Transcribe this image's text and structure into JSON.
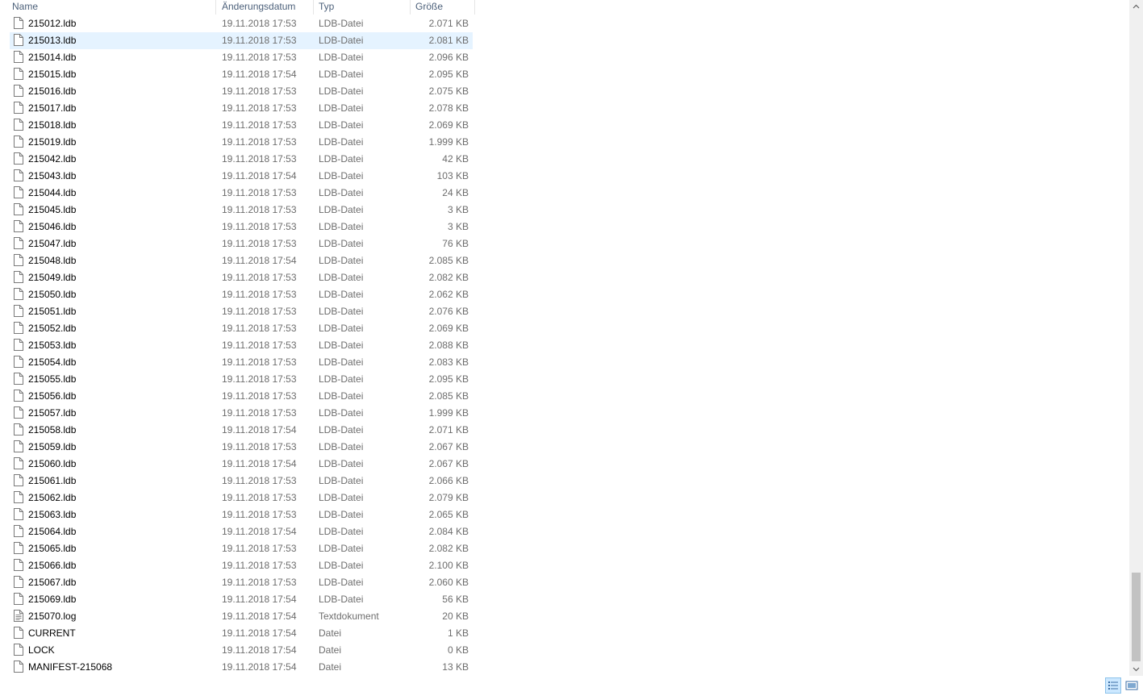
{
  "columns": {
    "name": "Name",
    "date": "Änderungsdatum",
    "type": "Typ",
    "size": "Größe"
  },
  "files": [
    {
      "name": "215012.ldb",
      "date": "19.11.2018 17:53",
      "type": "LDB-Datei",
      "size": "2.071 KB",
      "icon": "file-icon"
    },
    {
      "name": "215013.ldb",
      "date": "19.11.2018 17:53",
      "type": "LDB-Datei",
      "size": "2.081 KB",
      "icon": "file-icon",
      "selected": true
    },
    {
      "name": "215014.ldb",
      "date": "19.11.2018 17:53",
      "type": "LDB-Datei",
      "size": "2.096 KB",
      "icon": "file-icon"
    },
    {
      "name": "215015.ldb",
      "date": "19.11.2018 17:54",
      "type": "LDB-Datei",
      "size": "2.095 KB",
      "icon": "file-icon"
    },
    {
      "name": "215016.ldb",
      "date": "19.11.2018 17:53",
      "type": "LDB-Datei",
      "size": "2.075 KB",
      "icon": "file-icon"
    },
    {
      "name": "215017.ldb",
      "date": "19.11.2018 17:53",
      "type": "LDB-Datei",
      "size": "2.078 KB",
      "icon": "file-icon"
    },
    {
      "name": "215018.ldb",
      "date": "19.11.2018 17:53",
      "type": "LDB-Datei",
      "size": "2.069 KB",
      "icon": "file-icon"
    },
    {
      "name": "215019.ldb",
      "date": "19.11.2018 17:53",
      "type": "LDB-Datei",
      "size": "1.999 KB",
      "icon": "file-icon"
    },
    {
      "name": "215042.ldb",
      "date": "19.11.2018 17:53",
      "type": "LDB-Datei",
      "size": "42 KB",
      "icon": "file-icon"
    },
    {
      "name": "215043.ldb",
      "date": "19.11.2018 17:54",
      "type": "LDB-Datei",
      "size": "103 KB",
      "icon": "file-icon"
    },
    {
      "name": "215044.ldb",
      "date": "19.11.2018 17:53",
      "type": "LDB-Datei",
      "size": "24 KB",
      "icon": "file-icon"
    },
    {
      "name": "215045.ldb",
      "date": "19.11.2018 17:53",
      "type": "LDB-Datei",
      "size": "3 KB",
      "icon": "file-icon"
    },
    {
      "name": "215046.ldb",
      "date": "19.11.2018 17:53",
      "type": "LDB-Datei",
      "size": "3 KB",
      "icon": "file-icon"
    },
    {
      "name": "215047.ldb",
      "date": "19.11.2018 17:53",
      "type": "LDB-Datei",
      "size": "76 KB",
      "icon": "file-icon"
    },
    {
      "name": "215048.ldb",
      "date": "19.11.2018 17:54",
      "type": "LDB-Datei",
      "size": "2.085 KB",
      "icon": "file-icon"
    },
    {
      "name": "215049.ldb",
      "date": "19.11.2018 17:53",
      "type": "LDB-Datei",
      "size": "2.082 KB",
      "icon": "file-icon"
    },
    {
      "name": "215050.ldb",
      "date": "19.11.2018 17:53",
      "type": "LDB-Datei",
      "size": "2.062 KB",
      "icon": "file-icon"
    },
    {
      "name": "215051.ldb",
      "date": "19.11.2018 17:53",
      "type": "LDB-Datei",
      "size": "2.076 KB",
      "icon": "file-icon"
    },
    {
      "name": "215052.ldb",
      "date": "19.11.2018 17:53",
      "type": "LDB-Datei",
      "size": "2.069 KB",
      "icon": "file-icon"
    },
    {
      "name": "215053.ldb",
      "date": "19.11.2018 17:53",
      "type": "LDB-Datei",
      "size": "2.088 KB",
      "icon": "file-icon"
    },
    {
      "name": "215054.ldb",
      "date": "19.11.2018 17:53",
      "type": "LDB-Datei",
      "size": "2.083 KB",
      "icon": "file-icon"
    },
    {
      "name": "215055.ldb",
      "date": "19.11.2018 17:53",
      "type": "LDB-Datei",
      "size": "2.095 KB",
      "icon": "file-icon"
    },
    {
      "name": "215056.ldb",
      "date": "19.11.2018 17:53",
      "type": "LDB-Datei",
      "size": "2.085 KB",
      "icon": "file-icon"
    },
    {
      "name": "215057.ldb",
      "date": "19.11.2018 17:53",
      "type": "LDB-Datei",
      "size": "1.999 KB",
      "icon": "file-icon"
    },
    {
      "name": "215058.ldb",
      "date": "19.11.2018 17:54",
      "type": "LDB-Datei",
      "size": "2.071 KB",
      "icon": "file-icon"
    },
    {
      "name": "215059.ldb",
      "date": "19.11.2018 17:53",
      "type": "LDB-Datei",
      "size": "2.067 KB",
      "icon": "file-icon"
    },
    {
      "name": "215060.ldb",
      "date": "19.11.2018 17:54",
      "type": "LDB-Datei",
      "size": "2.067 KB",
      "icon": "file-icon"
    },
    {
      "name": "215061.ldb",
      "date": "19.11.2018 17:53",
      "type": "LDB-Datei",
      "size": "2.066 KB",
      "icon": "file-icon"
    },
    {
      "name": "215062.ldb",
      "date": "19.11.2018 17:53",
      "type": "LDB-Datei",
      "size": "2.079 KB",
      "icon": "file-icon"
    },
    {
      "name": "215063.ldb",
      "date": "19.11.2018 17:53",
      "type": "LDB-Datei",
      "size": "2.065 KB",
      "icon": "file-icon"
    },
    {
      "name": "215064.ldb",
      "date": "19.11.2018 17:54",
      "type": "LDB-Datei",
      "size": "2.084 KB",
      "icon": "file-icon"
    },
    {
      "name": "215065.ldb",
      "date": "19.11.2018 17:53",
      "type": "LDB-Datei",
      "size": "2.082 KB",
      "icon": "file-icon"
    },
    {
      "name": "215066.ldb",
      "date": "19.11.2018 17:53",
      "type": "LDB-Datei",
      "size": "2.100 KB",
      "icon": "file-icon"
    },
    {
      "name": "215067.ldb",
      "date": "19.11.2018 17:53",
      "type": "LDB-Datei",
      "size": "2.060 KB",
      "icon": "file-icon"
    },
    {
      "name": "215069.ldb",
      "date": "19.11.2018 17:54",
      "type": "LDB-Datei",
      "size": "56 KB",
      "icon": "file-icon"
    },
    {
      "name": "215070.log",
      "date": "19.11.2018 17:54",
      "type": "Textdokument",
      "size": "20 KB",
      "icon": "text-document-icon"
    },
    {
      "name": "CURRENT",
      "date": "19.11.2018 17:54",
      "type": "Datei",
      "size": "1 KB",
      "icon": "file-icon"
    },
    {
      "name": "LOCK",
      "date": "19.11.2018 17:54",
      "type": "Datei",
      "size": "0 KB",
      "icon": "file-icon"
    },
    {
      "name": "MANIFEST-215068",
      "date": "19.11.2018 17:54",
      "type": "Datei",
      "size": "13 KB",
      "icon": "file-icon"
    }
  ],
  "colors": {
    "header_text": "#4c607a",
    "secondary_text": "#6d6d6d",
    "selection": "#e5f3ff",
    "view_active": "#cce8ff"
  },
  "view": {
    "active": "details",
    "scroll_position": 0.85
  }
}
